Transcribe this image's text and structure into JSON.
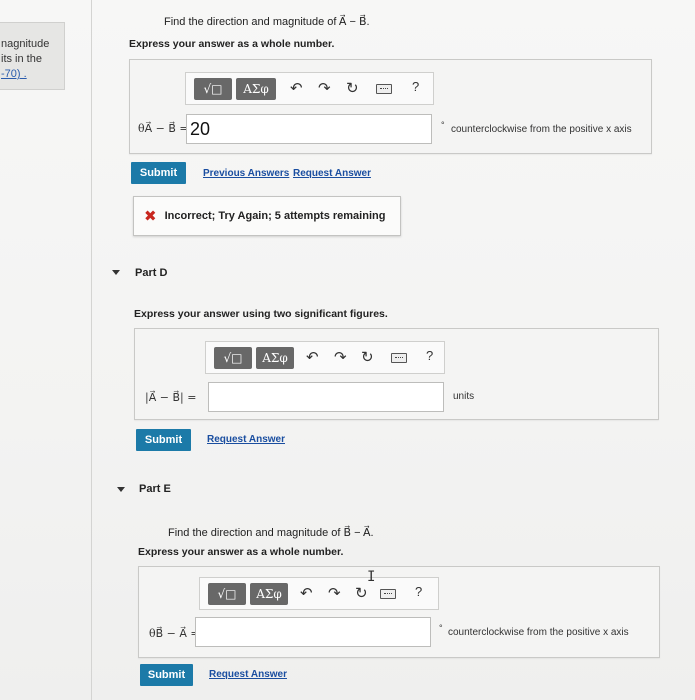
{
  "left_snippet": {
    "line1": "nagnitude",
    "line2": "its in the",
    "line3": "-70) ."
  },
  "part_c": {
    "question": "Find the direction and magnitude of A⃗ − B⃗.",
    "instruction": "Express your answer as a whole number.",
    "toolbar": {
      "templates_label": "√□",
      "greek_label": "ΑΣφ",
      "undo_icon": "undo-icon",
      "redo_icon": "redo-icon",
      "reset_icon": "reset-icon",
      "keyboard_icon": "keyboard-icon",
      "help_label": "?"
    },
    "answer_label": "θA⃗ − B⃗ =",
    "answer_value": "20",
    "unit_text": "counterclockwise from the positive x axis",
    "submit_label": "Submit",
    "previous_answers_label": "Previous Answers",
    "request_answer_label": "Request Answer",
    "feedback_text": "Incorrect; Try Again; 5 attempts remaining"
  },
  "part_d": {
    "heading": "Part D",
    "instruction": "Express your answer using two significant figures.",
    "toolbar": {
      "templates_label": "√□",
      "greek_label": "ΑΣφ",
      "help_label": "?"
    },
    "answer_label": "|A⃗ − B⃗| =",
    "answer_value": "",
    "unit_text": "units",
    "submit_label": "Submit",
    "request_answer_label": "Request Answer"
  },
  "part_e": {
    "heading": "Part E",
    "question": "Find the direction and magnitude of B⃗ − A⃗.",
    "instruction": "Express your answer as a whole number.",
    "toolbar": {
      "templates_label": "√□",
      "greek_label": "ΑΣφ",
      "help_label": "?"
    },
    "answer_label": "θB⃗ − A⃗ =",
    "answer_value": "",
    "unit_text": "counterclockwise from the positive x axis",
    "submit_label": "Submit",
    "request_answer_label": "Request Answer"
  },
  "colors": {
    "submit_bg": "#1c7aa8",
    "link": "#1a4ea0",
    "error": "#c8261e",
    "toolbar_button": "#686868"
  }
}
